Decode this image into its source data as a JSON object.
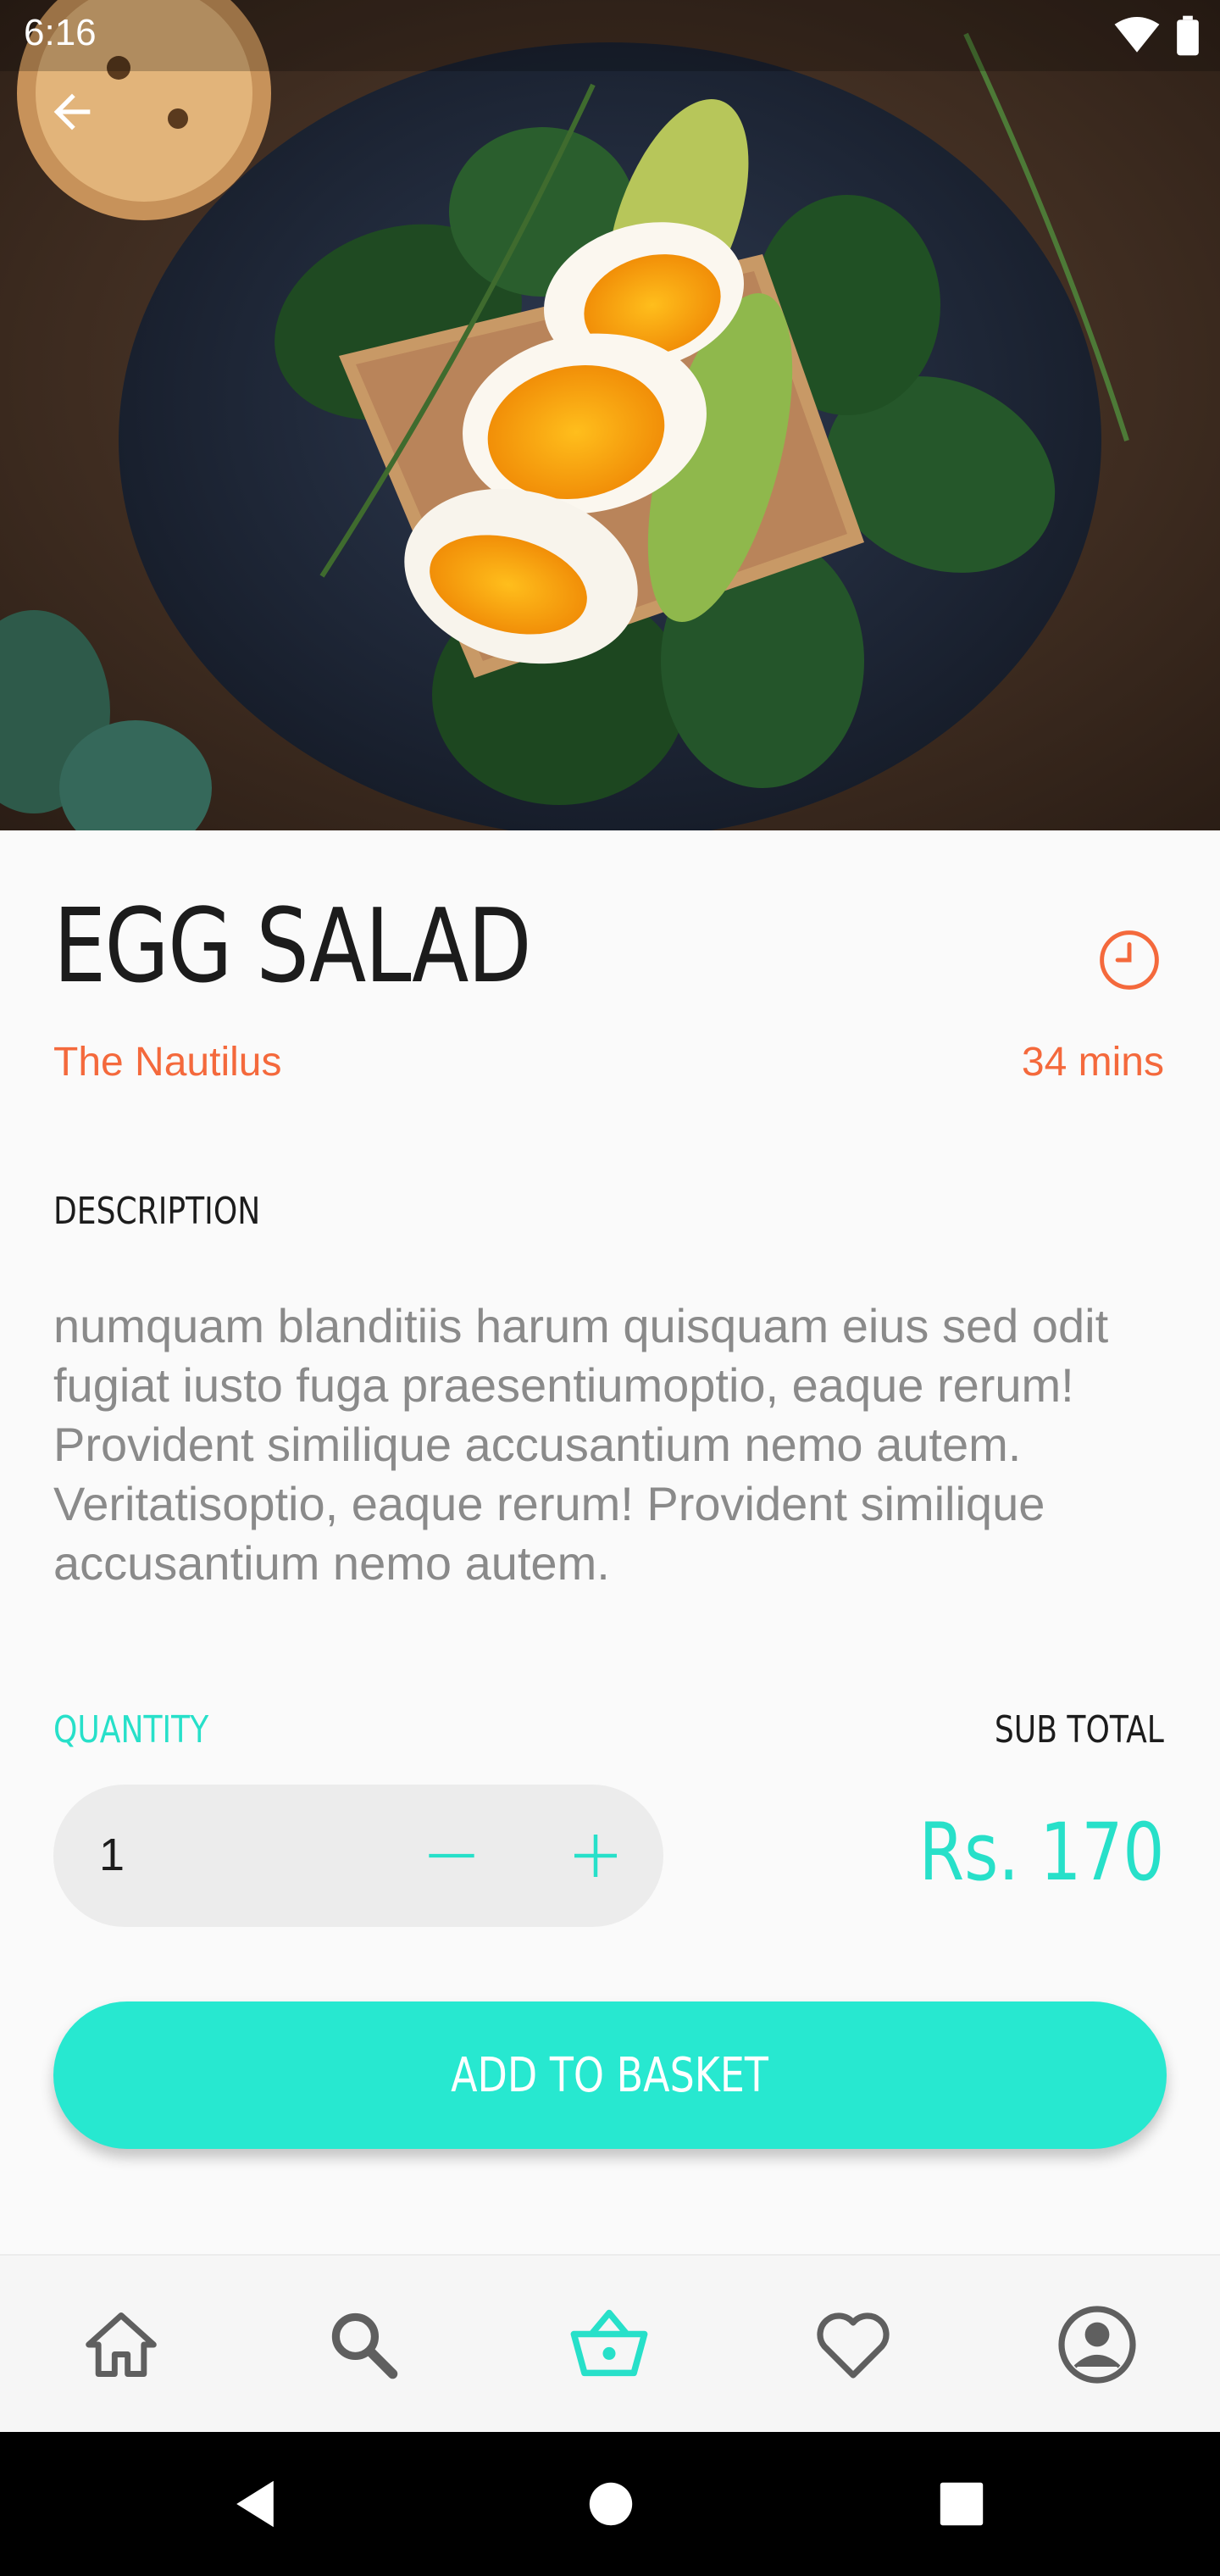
{
  "status_bar": {
    "time": "6:16"
  },
  "dish": {
    "name": "EGG SALAD",
    "restaurant": "The Nautilus",
    "prep_time": "34 mins"
  },
  "description": {
    "label": "DESCRIPTION",
    "text": "numquam blanditiis harum quisquam eius sed odit fugiat iusto fuga praesentiumoptio, eaque rerum! Provident similique accusantium nemo autem. Veritatisoptio, eaque rerum! Provident similique accusantium nemo autem."
  },
  "order": {
    "quantity_label": "QUANTITY",
    "quantity": "1",
    "subtotal_label": "SUB TOTAL",
    "subtotal": "Rs. 170",
    "add_button": "ADD TO BASKET"
  },
  "bottom_nav": {
    "active": "basket",
    "items": [
      "home-icon",
      "search-icon",
      "basket-icon",
      "heart-icon",
      "account-icon"
    ]
  },
  "colors": {
    "accent": "#27e0c9",
    "orange": "#f4693c",
    "text": "#1c1c1c",
    "muted": "#8a8a8a"
  }
}
